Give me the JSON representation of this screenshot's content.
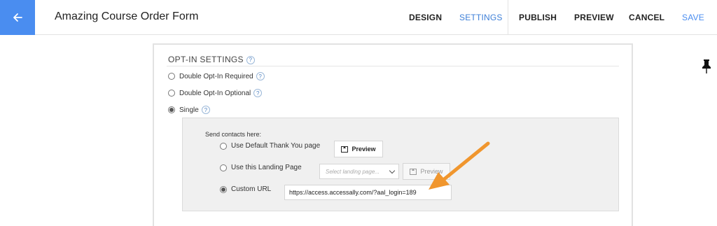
{
  "header": {
    "title": "Amazing Course Order Form",
    "nav": {
      "design": "DESIGN",
      "settings": "SETTINGS",
      "publish": "PUBLISH",
      "preview": "PREVIEW",
      "cancel": "CANCEL",
      "save": "SAVE"
    }
  },
  "optin": {
    "title": "OPT-IN SETTINGS",
    "help": "?",
    "options": [
      {
        "label": "Double Opt-In Required",
        "selected": false
      },
      {
        "label": "Double Opt-In Optional",
        "selected": false
      },
      {
        "label": "Single",
        "selected": true
      }
    ]
  },
  "send_contacts": {
    "label": "Send contacts here:",
    "options": [
      {
        "label": "Use Default Thank You page",
        "selected": false
      },
      {
        "label": "Use this Landing Page",
        "selected": false
      },
      {
        "label": "Custom URL",
        "selected": true
      }
    ],
    "preview_label": "Preview",
    "landing_placeholder": "Select landing page...",
    "custom_url_value": "https://access.accessally.com/?aal_login=189"
  },
  "colors": {
    "accent": "#4a8df0",
    "arrow": "#f0962e",
    "subbox_bg": "#f0f0f0"
  }
}
